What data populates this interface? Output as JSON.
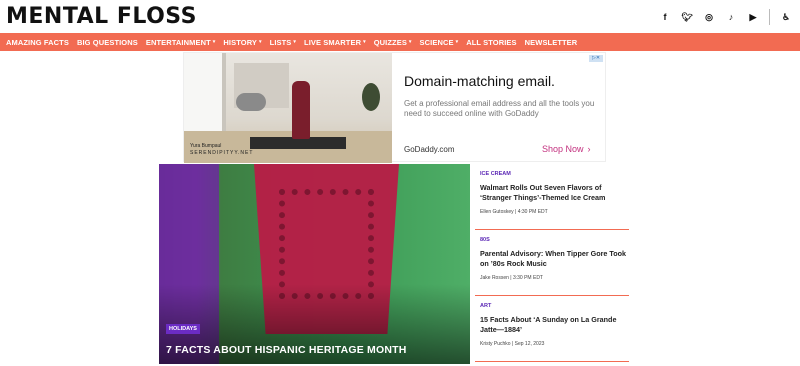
{
  "site": {
    "logo": "MENTAL FLOSS",
    "social_icons": [
      "facebook-icon",
      "twitter-icon",
      "instagram-icon",
      "tiktok-icon",
      "youtube-icon",
      "accessibility-icon"
    ]
  },
  "nav": {
    "items": [
      {
        "label": "AMAZING FACTS",
        "dropdown": false
      },
      {
        "label": "BIG QUESTIONS",
        "dropdown": false
      },
      {
        "label": "ENTERTAINMENT",
        "dropdown": true
      },
      {
        "label": "HISTORY",
        "dropdown": true
      },
      {
        "label": "LISTS",
        "dropdown": true
      },
      {
        "label": "LIVE SMARTER",
        "dropdown": true
      },
      {
        "label": "QUIZZES",
        "dropdown": true
      },
      {
        "label": "SCIENCE",
        "dropdown": true
      },
      {
        "label": "ALL STORIES",
        "dropdown": false
      },
      {
        "label": "NEWSLETTER",
        "dropdown": false
      }
    ],
    "caret": "▾"
  },
  "ad": {
    "title": "Domain-matching email.",
    "description": "Get a professional email address and all the tools you need to succeed online with GoDaddy",
    "domain": "GoDaddy.com",
    "cta": "Shop Now",
    "cta_icon": "›",
    "photo_credit_name": "Yura Bumpaul",
    "photo_credit_site": "SERENDIPITYY.NET"
  },
  "hero": {
    "tag": "HOLIDAYS",
    "title": "7 FACTS ABOUT HISPANIC HERITAGE MONTH"
  },
  "stories": [
    {
      "category": "ICE CREAM",
      "title": "Walmart Rolls Out Seven Flavors of ‘Stranger Things’-Themed Ice Cream",
      "meta": "Ellen Gutoskey  |  4:30 PM EDT"
    },
    {
      "category": "80S",
      "title": "Parental Advisory: When Tipper Gore Took on ’80s Rock Music",
      "meta": "Jake Rossen  |  3:30 PM EDT"
    },
    {
      "category": "ART",
      "title": "15 Facts About ‘A Sunday on La Grande Jatte—1884’",
      "meta": "Kristy Puchko  |  Sep 12, 2023"
    }
  ],
  "colors": {
    "nav_bg": "#f26b52",
    "tag_purple": "#5b27b5",
    "cta_pink": "#c3317f"
  }
}
